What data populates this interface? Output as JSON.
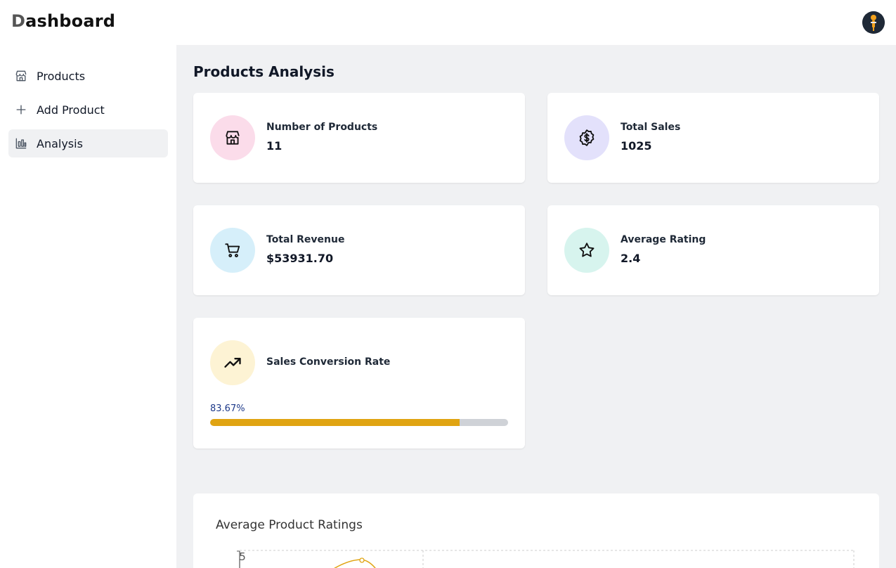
{
  "header": {
    "brand_first": "D",
    "brand_rest": "ashboard",
    "avatar_icon": "user-avatar-icon"
  },
  "sidebar": {
    "items": [
      {
        "label": "Products",
        "icon": "store-icon"
      },
      {
        "label": "Add Product",
        "icon": "plus-icon"
      },
      {
        "label": "Analysis",
        "icon": "bar-chart-icon",
        "active": true
      }
    ]
  },
  "main": {
    "title": "Products Analysis",
    "stats": [
      {
        "label": "Number of Products",
        "value": "11",
        "icon": "store-icon",
        "color": "#fbdcea"
      },
      {
        "label": "Total Sales",
        "value": "1025",
        "icon": "dollar-badge-icon",
        "color": "#e3e1fb"
      },
      {
        "label": "Total Revenue",
        "value": "$53931.70",
        "icon": "cart-icon",
        "color": "#d6effa"
      },
      {
        "label": "Average Rating",
        "value": "2.4",
        "icon": "star-icon",
        "color": "#d7f4ee"
      }
    ],
    "conversion": {
      "label": "Sales Conversion Rate",
      "value_text": "83.67%",
      "fraction": 0.8367,
      "icon": "trending-up-icon",
      "color": "#fdf3d4",
      "bar_color": "#e0a412"
    },
    "ratings_chart": {
      "title": "Average Product Ratings",
      "ytick_top": "5"
    }
  }
}
